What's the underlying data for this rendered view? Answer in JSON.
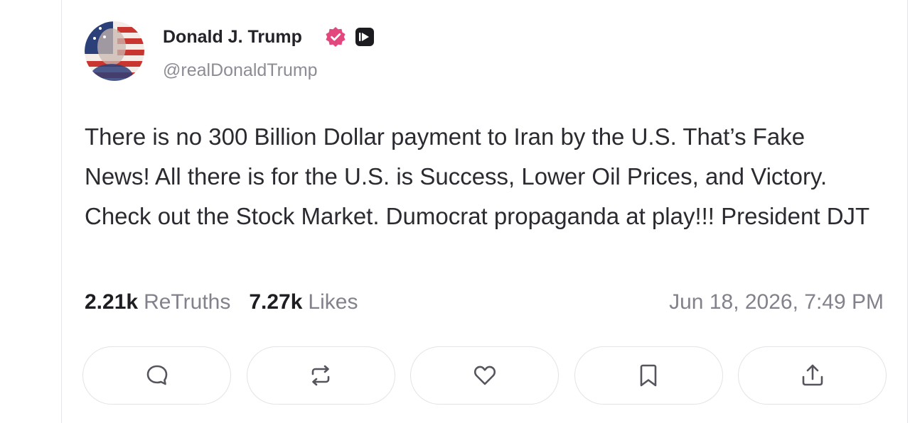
{
  "post": {
    "author": {
      "display_name": "Donald J. Trump",
      "handle": "@realDonaldTrump",
      "verified_icon": "verified-badge-icon",
      "media_badge_icon": "play-badge-icon",
      "verified_color": "#e2477e"
    },
    "text": "There is no 300 Billion Dollar payment to Iran by the U.S. That’s Fake News! All there is for the U.S. is Success, Lower Oil Prices, and Victory. Check out the Stock Market. Dumocrat propaganda at play!!! President DJT",
    "stats": {
      "retruths_count": "2.21k",
      "retruths_label": "ReTruths",
      "likes_count": "7.27k",
      "likes_label": "Likes"
    },
    "timestamp": "Jun 18, 2026, 7:49 PM",
    "actions": [
      "reply-icon",
      "retruth-icon",
      "like-icon",
      "bookmark-icon",
      "share-icon"
    ]
  }
}
